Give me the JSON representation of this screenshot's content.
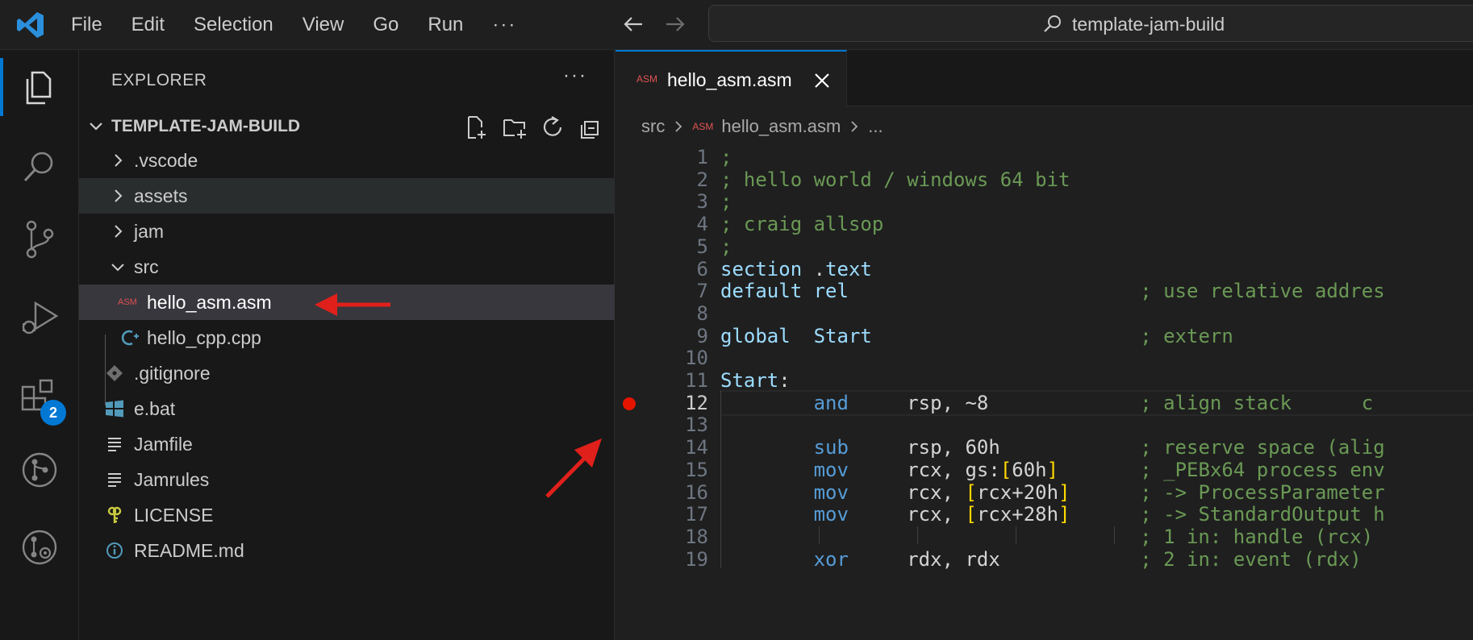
{
  "menu": [
    "File",
    "Edit",
    "Selection",
    "View",
    "Go",
    "Run"
  ],
  "menu_more": "···",
  "command_center": {
    "text": "template-jam-build"
  },
  "activity": {
    "extensions_badge": "2"
  },
  "sidebar": {
    "title": "EXPLORER",
    "more": "···",
    "section": "TEMPLATE-JAM-BUILD",
    "tree": [
      {
        "name": ".vscode"
      },
      {
        "name": "assets"
      },
      {
        "name": "jam"
      },
      {
        "name": "src"
      },
      {
        "name": "hello_asm.asm",
        "icon_text": "ASM"
      },
      {
        "name": "hello_cpp.cpp"
      },
      {
        "name": ".gitignore"
      },
      {
        "name": "e.bat"
      },
      {
        "name": "Jamfile"
      },
      {
        "name": "Jamrules"
      },
      {
        "name": "LICENSE"
      },
      {
        "name": "README.md"
      }
    ]
  },
  "editor": {
    "tab": {
      "label": "hello_asm.asm",
      "icon_text": "ASM"
    },
    "breadcrumb": {
      "folder": "src",
      "file": "hello_asm.asm",
      "tail": "...",
      "icon_text": "ASM"
    },
    "breakpoint_line": 12,
    "lines": [
      {
        "n": "1",
        "t": ";"
      },
      {
        "n": "2",
        "t": "; hello world / windows 64 bit"
      },
      {
        "n": "3",
        "t": ";"
      },
      {
        "n": "4",
        "t": "; craig allsop"
      },
      {
        "n": "5",
        "t": ";"
      },
      {
        "n": "6",
        "t": "section .text"
      },
      {
        "n": "7",
        "t": "default rel                         ; use relative addres"
      },
      {
        "n": "8",
        "t": ""
      },
      {
        "n": "9",
        "t": "global  Start                       ; extern"
      },
      {
        "n": "10",
        "t": ""
      },
      {
        "n": "11",
        "t": "Start:"
      },
      {
        "n": "12",
        "t": "        and     rsp, ~8             ; align stack      c"
      },
      {
        "n": "13",
        "t": ""
      },
      {
        "n": "14",
        "t": "        sub     rsp, 60h            ; reserve space (alig"
      },
      {
        "n": "15",
        "t": "        mov     rcx, gs:[60h]       ; _PEBx64 process env"
      },
      {
        "n": "16",
        "t": "        mov     rcx, [rcx+20h]      ; -> ProcessParameter"
      },
      {
        "n": "17",
        "t": "        mov     rcx, [rcx+28h]      ; -> StandardOutput h"
      },
      {
        "n": "18",
        "t": "                                    ; 1 in: handle (rcx)"
      },
      {
        "n": "19",
        "t": "        xor     rdx, rdx            ; 2 in: event (rdx)"
      }
    ]
  },
  "colors": {
    "accent": "#0078d4",
    "breakpoint": "#e51400",
    "annotation_arrow": "#e0201b"
  }
}
